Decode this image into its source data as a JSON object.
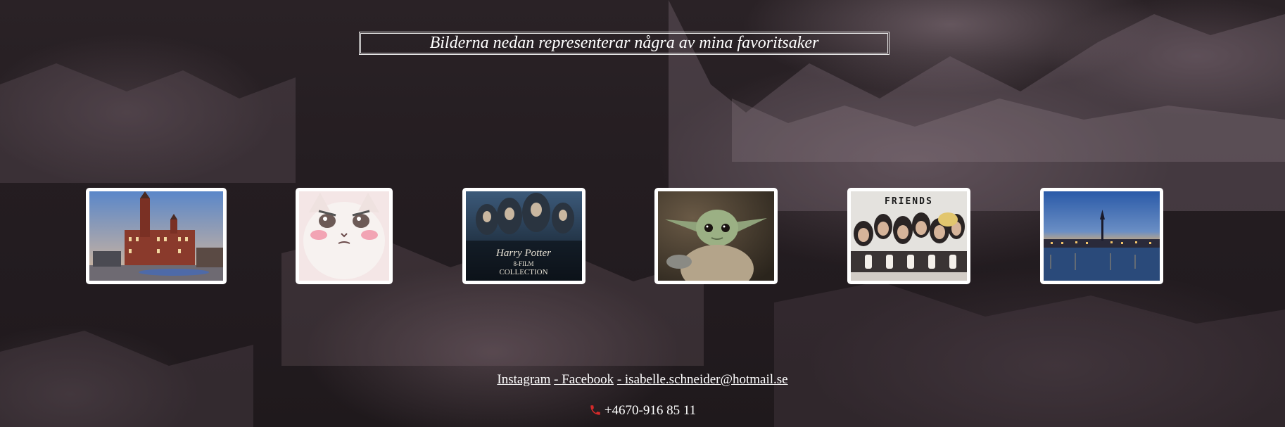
{
  "header": {
    "title": "Bilderna nedan representerar några av mina favoritsaker"
  },
  "gallery": {
    "items": [
      {
        "subject": "town-hall-photo"
      },
      {
        "subject": "white-cat-photo"
      },
      {
        "subject": "harry-potter-poster",
        "poster_title": "Harry Potter",
        "poster_subtitle": "8-FILM",
        "poster_subtitle2": "COLLECTION"
      },
      {
        "subject": "baby-yoda-photo"
      },
      {
        "subject": "friends-poster",
        "poster_title": "FRIENDS"
      },
      {
        "subject": "city-skyline-photo"
      }
    ]
  },
  "footer": {
    "instagram": "Instagram",
    "facebook": "- Facebook",
    "email": "- isabelle.schneider@hotmail.se",
    "phone_icon": "phone-icon",
    "phone": "+4670-916 85 11"
  }
}
